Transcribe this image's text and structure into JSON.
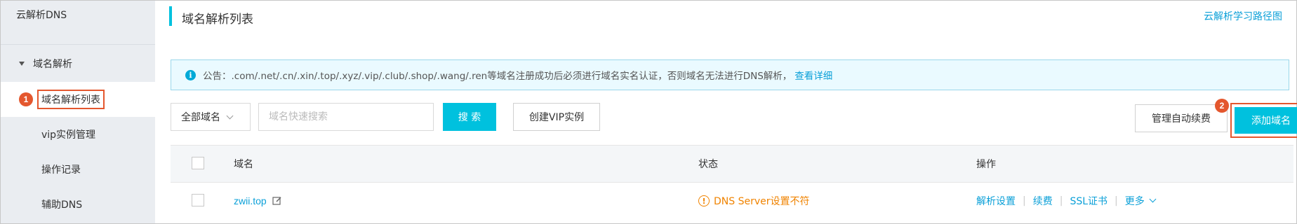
{
  "sidebar": {
    "title": "云解析DNS",
    "group_label": "域名解析",
    "items": [
      {
        "label": "域名解析列表",
        "active": true,
        "badge": "1"
      },
      {
        "label": "vip实例管理"
      },
      {
        "label": "操作记录"
      },
      {
        "label": "辅助DNS"
      }
    ]
  },
  "header": {
    "title": "域名解析列表",
    "help_link": "云解析学习路径图"
  },
  "notice": {
    "text": "公告：.com/.net/.cn/.xin/.top/.xyz/.vip/.club/.shop/.wang/.ren等域名注册成功后必须进行域名实名认证，否则域名无法进行DNS解析，",
    "link": "查看详细"
  },
  "toolbar": {
    "filter_value": "全部域名",
    "search_placeholder": "域名快速搜索",
    "search_button": "搜 索",
    "create_vip_button": "创建VIP实例",
    "auto_renew_button": "管理自动续费",
    "add_domain_button": "添加域名",
    "add_badge": "2"
  },
  "table": {
    "columns": {
      "domain": "域名",
      "status": "状态",
      "ops": "操作"
    },
    "rows": [
      {
        "domain": "zwii.top",
        "status": "DNS Server设置不符",
        "ops": {
          "resolve": "解析设置",
          "renew": "续费",
          "ssl": "SSL证书",
          "more": "更多"
        }
      }
    ]
  },
  "colors": {
    "accent": "#00c1de",
    "link": "#0ba0d8",
    "warning": "#f08300",
    "highlight": "#e4572e"
  }
}
